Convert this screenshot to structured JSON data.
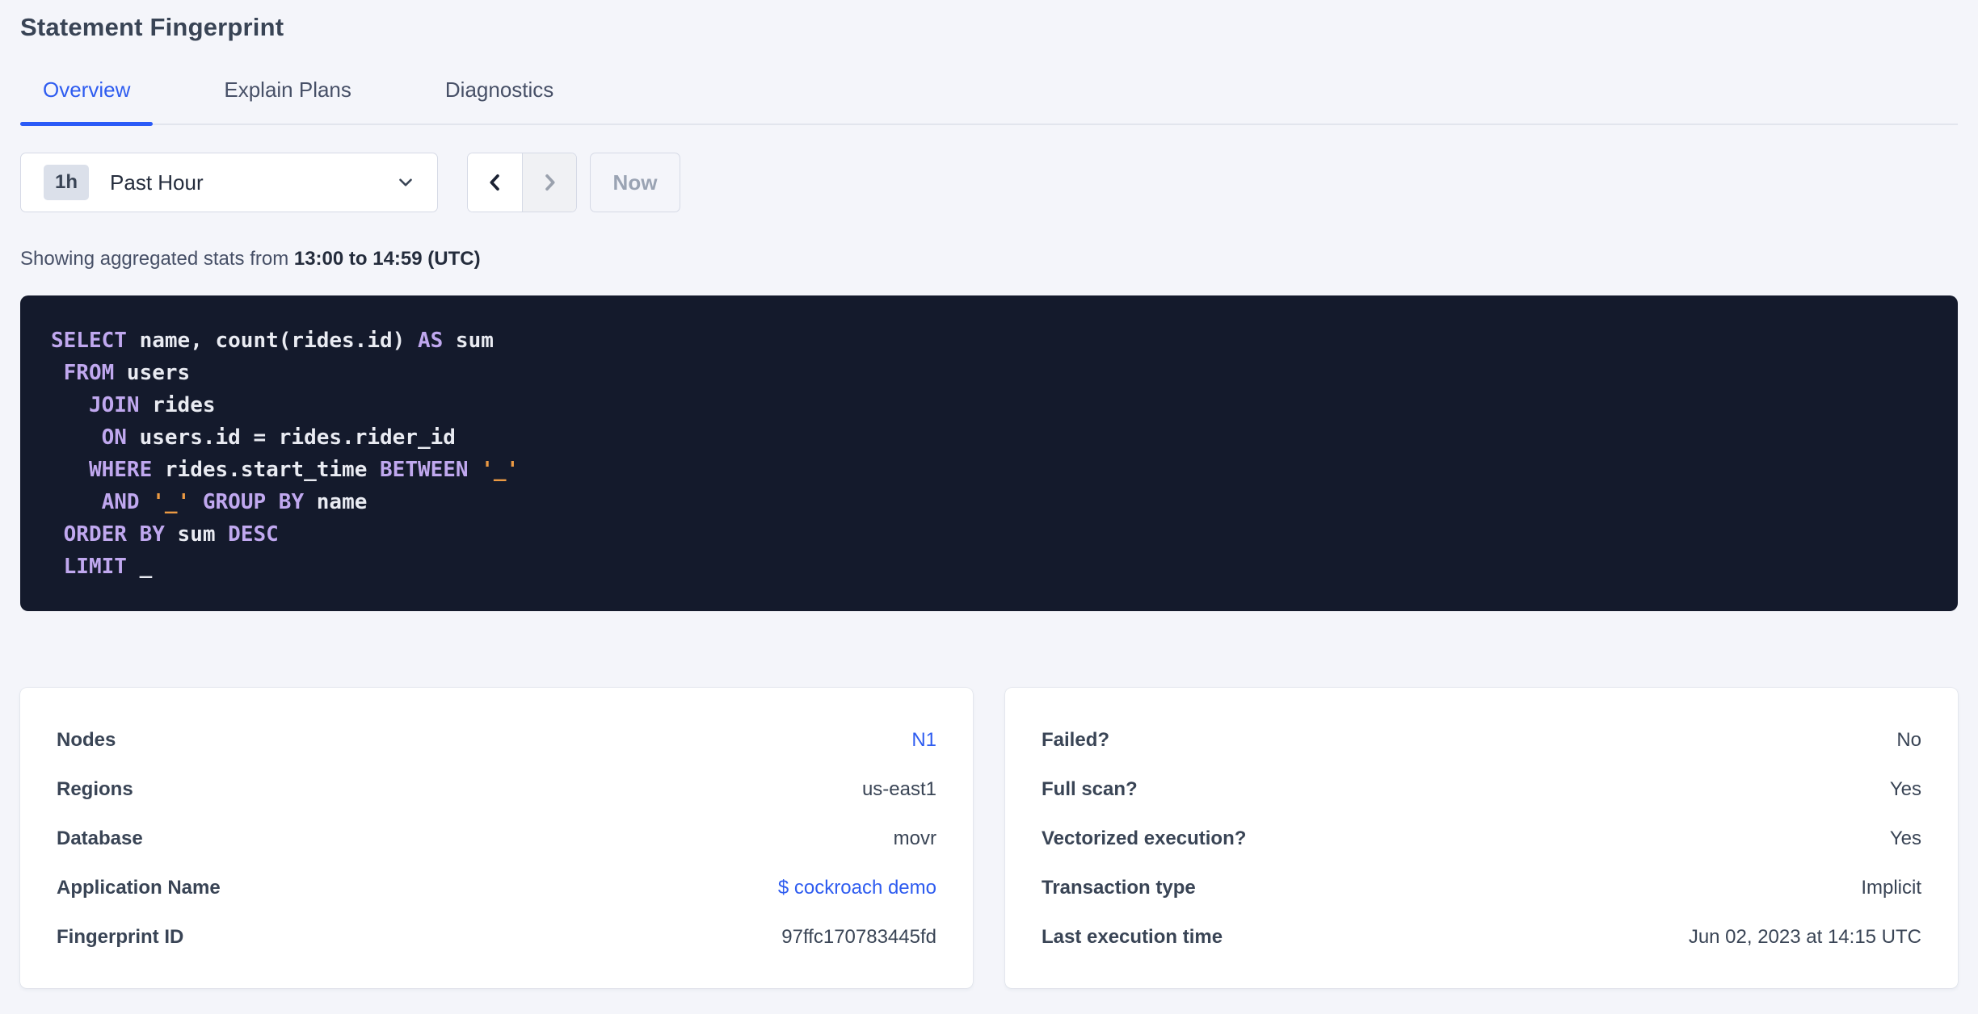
{
  "page": {
    "title": "Statement Fingerprint"
  },
  "tabs": {
    "items": [
      {
        "label": "Overview",
        "active": true
      },
      {
        "label": "Explain Plans",
        "active": false
      },
      {
        "label": "Diagnostics",
        "active": false
      }
    ]
  },
  "time_picker": {
    "badge": "1h",
    "selected": "Past Hour",
    "now_label": "Now"
  },
  "summary": {
    "prefix": "Showing aggregated stats from ",
    "range": "13:00 to 14:59 (UTC)"
  },
  "sql": {
    "lines": [
      [
        [
          "kw",
          "SELECT"
        ],
        [
          "pl",
          " name, count(rides.id) "
        ],
        [
          "kw",
          "AS"
        ],
        [
          "pl",
          " sum"
        ]
      ],
      [
        [
          "pl",
          " "
        ],
        [
          "kw",
          "FROM"
        ],
        [
          "pl",
          " users"
        ]
      ],
      [
        [
          "pl",
          "   "
        ],
        [
          "kw",
          "JOIN"
        ],
        [
          "pl",
          " rides"
        ]
      ],
      [
        [
          "pl",
          "    "
        ],
        [
          "kw",
          "ON"
        ],
        [
          "pl",
          " users.id = rides.rider_id"
        ]
      ],
      [
        [
          "pl",
          "   "
        ],
        [
          "kw",
          "WHERE"
        ],
        [
          "pl",
          " rides.start_time "
        ],
        [
          "kw",
          "BETWEEN"
        ],
        [
          "pl",
          " "
        ],
        [
          "lit",
          "'_'"
        ]
      ],
      [
        [
          "pl",
          "    "
        ],
        [
          "kw",
          "AND"
        ],
        [
          "pl",
          " "
        ],
        [
          "lit",
          "'_'"
        ],
        [
          "pl",
          " "
        ],
        [
          "kw",
          "GROUP BY"
        ],
        [
          "pl",
          " name"
        ]
      ],
      [
        [
          "pl",
          " "
        ],
        [
          "kw",
          "ORDER BY"
        ],
        [
          "pl",
          " sum "
        ],
        [
          "kw",
          "DESC"
        ]
      ],
      [
        [
          "pl",
          " "
        ],
        [
          "kw",
          "LIMIT"
        ],
        [
          "pl",
          " _"
        ]
      ]
    ]
  },
  "cards": [
    {
      "rows": [
        {
          "label": "Nodes",
          "value": "N1",
          "link": true
        },
        {
          "label": "Regions",
          "value": "us-east1",
          "link": false
        },
        {
          "label": "Database",
          "value": "movr",
          "link": false
        },
        {
          "label": "Application Name",
          "value": "$ cockroach demo",
          "link": true
        },
        {
          "label": "Fingerprint ID",
          "value": "97ffc170783445fd",
          "link": false
        }
      ]
    },
    {
      "rows": [
        {
          "label": "Failed?",
          "value": "No",
          "link": false
        },
        {
          "label": "Full scan?",
          "value": "Yes",
          "link": false
        },
        {
          "label": "Vectorized execution?",
          "value": "Yes",
          "link": false
        },
        {
          "label": "Transaction type",
          "value": "Implicit",
          "link": false
        },
        {
          "label": "Last execution time",
          "value": "Jun 02, 2023 at 14:15 UTC",
          "link": false
        }
      ]
    }
  ],
  "colors": {
    "page_bg": "#f4f5fa",
    "accent_blue": "#2e5cf0",
    "tab_underline": "#2b5bf7",
    "sql_bg": "#141a2c",
    "sql_keyword": "#c0a8ef",
    "sql_plain": "#e9ebf2",
    "sql_literal": "#ec9a43",
    "disabled_text": "#9aa3b3",
    "label_text": "#394455"
  }
}
